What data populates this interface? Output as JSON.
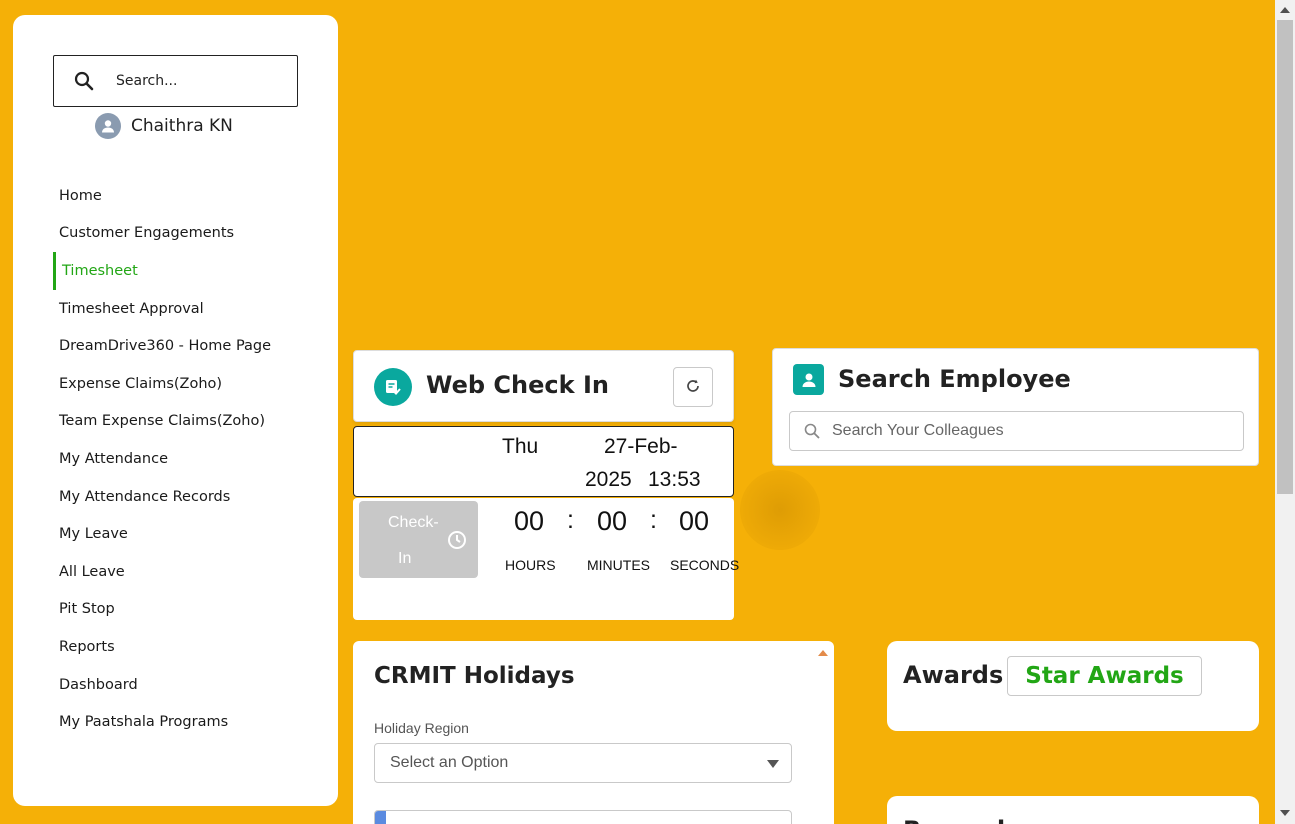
{
  "sidebar": {
    "search_placeholder": "Search...",
    "user_name": "Chaithra KN",
    "items": [
      {
        "label": "Home"
      },
      {
        "label": "Customer Engagements"
      },
      {
        "label": "Timesheet",
        "active": true
      },
      {
        "label": "Timesheet Approval"
      },
      {
        "label": "DreamDrive360 - Home Page"
      },
      {
        "label": "Expense Claims(Zoho)"
      },
      {
        "label": "Team Expense Claims(Zoho)"
      },
      {
        "label": "My Attendance"
      },
      {
        "label": "My Attendance Records"
      },
      {
        "label": "My Leave"
      },
      {
        "label": "All Leave"
      },
      {
        "label": "Pit Stop"
      },
      {
        "label": "Reports"
      },
      {
        "label": "Dashboard"
      },
      {
        "label": "My Paatshala Programs"
      }
    ]
  },
  "web_check_in": {
    "title": "Web Check In",
    "day": "Thu",
    "date_part1": "27-Feb-",
    "date_part2": "2025",
    "time": "13:53",
    "checkin_line1": "Check-",
    "checkin_line2": "In",
    "hours": "00",
    "minutes": "00",
    "seconds": "00",
    "separator": ":",
    "hours_label": "HOURS",
    "minutes_label": "MINUTES",
    "seconds_label": "SECONDS"
  },
  "search_employee": {
    "title": "Search Employee",
    "placeholder": "Search Your Colleagues"
  },
  "holidays": {
    "title": "CRMIT Holidays",
    "region_label": "Holiday Region",
    "select_value": "Select an Option"
  },
  "awards": {
    "title": "Awards",
    "button_label": "Star Awards"
  },
  "rewards": {
    "title": "Rewards"
  },
  "colors": {
    "background": "#F5B007",
    "accent_green": "#22a615",
    "teal": "#0aa89e"
  }
}
